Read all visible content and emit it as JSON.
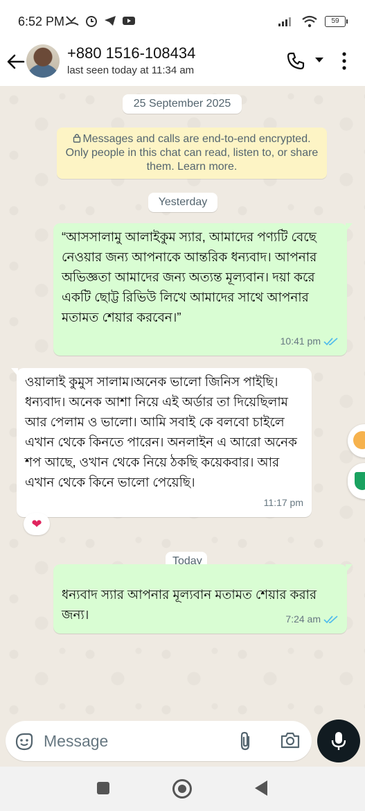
{
  "status_bar": {
    "time": "6:52 PM",
    "battery": "59"
  },
  "header": {
    "contact_name": "+880 1516-108434",
    "last_seen": "last seen today at 11:34 am"
  },
  "chat": {
    "date_separator_1": "25 September 2025",
    "encryption_notice": "Messages and calls are end-to-end encrypted. Only people in this chat can read, listen to, or share them. Learn more.",
    "date_separator_2": "Yesterday",
    "date_separator_3": "Today",
    "messages": [
      {
        "direction": "outgoing",
        "text": "“আসসালামু আলাইকুম স্যার, আমাদের পণ্যটি বেছে নেওয়ার জন্য আপনাকে আন্তরিক ধন্যবাদ। আপনার অভিজ্ঞতা আমাদের জন্য অত্যন্ত মূল্যবান। দয়া করে একটি ছোট্ট রিভিউ লিখে আমাদের সাথে আপনার মতামত শেয়ার করবেন।”",
        "time": "10:41 pm",
        "status": "read"
      },
      {
        "direction": "incoming",
        "text": "ওয়ালাই কুমুস সালাম।অনেক ভালো জিনিস পাইছি।ধন্যবাদ। অনেক আশা নিয়ে এই অর্ডার তা দিয়েছিলাম আর পেলাম ও ভালো। আমি সবাই কে বলবো চাইলে এখান থেকে কিনতে পারেন। অনলাইন এ আরো অনেক শপ আছে, ওখান থেকে নিয়ে ঠকছি কয়েকবার। আর এখান থেকে কিনে ভালো পেয়েছি।",
        "time": "11:17 pm",
        "reaction": "❤"
      },
      {
        "direction": "outgoing",
        "text": "ধন্যবাদ স্যার আপনার মূল্যবান মতামত শেয়ার করার জন্য।",
        "time": "7:24 am",
        "status": "read"
      }
    ]
  },
  "input": {
    "placeholder": "Message"
  },
  "colors": {
    "outgoing_bubble": "#d9fdd3",
    "incoming_bubble": "#ffffff",
    "read_ticks": "#53bdeb",
    "chat_bg": "#efeae2"
  }
}
